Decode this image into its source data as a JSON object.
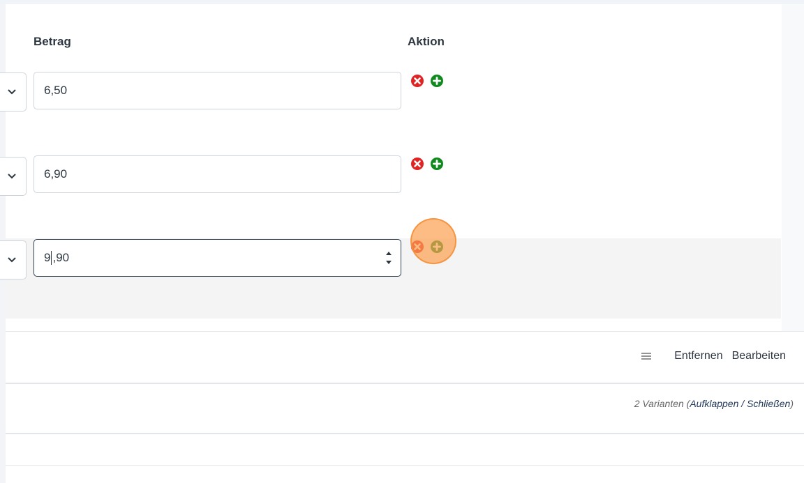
{
  "table": {
    "headers": {
      "amount": "Betrag",
      "action": "Aktion"
    },
    "rows": [
      {
        "amount": "6,50"
      },
      {
        "amount": "6,90"
      },
      {
        "amount_before_caret": "9",
        "amount_after_caret": ",90"
      }
    ]
  },
  "footer": {
    "remove_label": "Entfernen",
    "edit_label": "Bearbeiten",
    "menu_icon": "menu-lines-icon"
  },
  "variants": {
    "count_text": "2 Varianten (",
    "expand": "Aufklappen",
    "separator": " / ",
    "collapse": "Schließen",
    "close_paren": ")"
  },
  "colors": {
    "remove_red": "#e02424",
    "add_green": "#108a1e",
    "focus_border": "#2c3e50",
    "highlight": "#f4f4f4"
  }
}
